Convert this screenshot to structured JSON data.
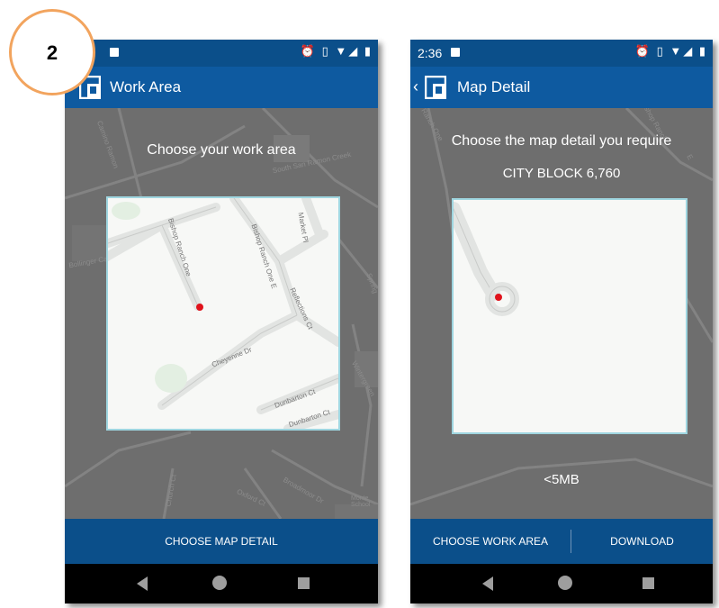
{
  "colors": {
    "status_bar": "#0b4f8a",
    "app_bar": "#0e5aa0",
    "bottom_bar": "#0b4f8a",
    "map_dim": "#6e6e6e",
    "frame_border": "#9fd6e0",
    "location_dot": "#e0121b",
    "badge_ring": "#f2a45e"
  },
  "badge": {
    "number": "2"
  },
  "left_screen": {
    "status_icons": "⏰ ▯ ▼◢ ▮",
    "title": "Work Area",
    "prompt": "Choose your work area",
    "map_labels": {
      "bollinger": "Bollinger Canyon Rd",
      "bishop_one": "Bishop Ranch One",
      "bishop_one_e": "Bishop Ranch One E",
      "market": "Market Pl",
      "reflections": "Reflections Ct",
      "cheyenne": "Cheyenne Dr",
      "dunbarton_ct": "Dunbarton Ct",
      "dunbarton_c": "Dunbarton Ct",
      "south_san_ramon": "South San Ramon Creek",
      "camino": "Camino Ramon",
      "monte": "Monte School",
      "oxford": "Oxford Ct",
      "church": "Church Ct",
      "broadmoor": "Broadmoor Dr",
      "wintergreen": "Wintergreen",
      "spring": "Spring"
    },
    "button": "CHOOSE MAP DETAIL"
  },
  "right_screen": {
    "time": "2:36",
    "status_icons": "⏰ ▯ ▼◢ ▮",
    "title": "Map Detail",
    "prompt": "Choose the map detail you require",
    "detail_level": "CITY BLOCK 6,760",
    "size_estimate": "<5MB",
    "map_labels": {
      "ranch_one": "Ranch One",
      "bishop": "Bishop Ranch",
      "e": "E"
    },
    "buttons": {
      "choose_work_area": "CHOOSE WORK AREA",
      "download": "DOWNLOAD"
    }
  }
}
